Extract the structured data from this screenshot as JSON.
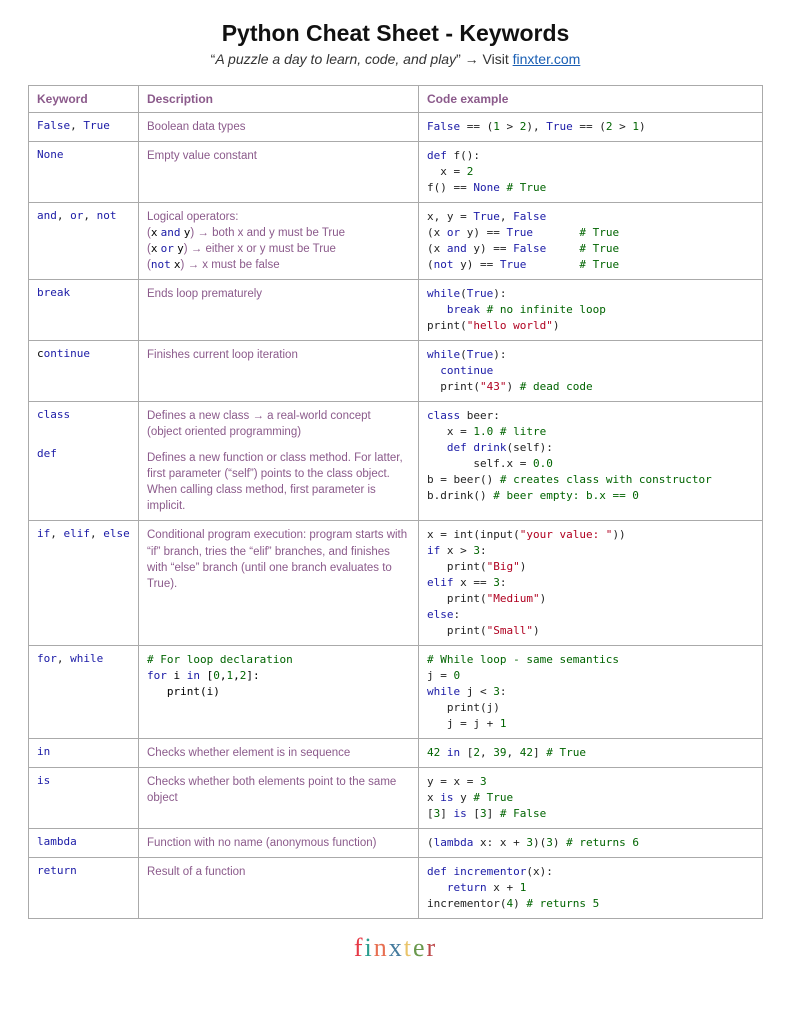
{
  "header": {
    "title": "Python Cheat Sheet - Keywords",
    "tagline_prefix": "“",
    "tagline": "A puzzle a day to learn, code, and play",
    "tagline_suffix": "” → Visit ",
    "link_text": "finxter.com"
  },
  "columns": {
    "keyword": "Keyword",
    "description": "Description",
    "code": "Code example"
  },
  "rows": [
    {
      "kw_html": "<span class='k'>False</span>, <span class='k'>True</span>",
      "desc_html": "Boolean data types",
      "code_html": "<span class='k'>False</span> == (<span class='n'>1</span> &gt; <span class='n'>2</span>), <span class='k'>True</span> == (<span class='n'>2</span> &gt; <span class='n'>1</span>)"
    },
    {
      "kw_html": "<span class='k'>None</span>",
      "desc_html": "Empty value constant",
      "code_html": "<span class='k'>def</span> f():\n  x = <span class='n'>2</span>\nf() == <span class='k'>None</span> <span class='c'># True</span>"
    },
    {
      "kw_html": "<span class='k'>and</span>, <span class='k'>or</span>, <span class='k'>not</span>",
      "desc_html": "Logical operators:<br>(<span class='code-inline bk'>x</span> <span class='code-inline k'>and</span> <span class='code-inline bk'>y</span>) → both x and y must be True<br>(<span class='code-inline bk'>x</span> <span class='code-inline k'>or</span> <span class='code-inline bk'>y</span>) → either x or y must be True<br>(<span class='code-inline k'>not</span> <span class='code-inline bk'>x</span>) → x must be false",
      "code_html": "x, y = <span class='k'>True</span>, <span class='k'>False</span>\n(x <span class='k'>or</span> y) == <span class='k'>True</span>       <span class='c'># True</span>\n(x <span class='k'>and</span> y) == <span class='k'>False</span>     <span class='c'># True</span>\n(<span class='k'>not</span> y) == <span class='k'>True</span>        <span class='c'># True</span>"
    },
    {
      "kw_html": "<span class='k'>break</span>",
      "desc_html": "Ends loop prematurely",
      "code_html": "<span class='k'>while</span>(<span class='k'>True</span>):\n   <span class='k'>break</span> <span class='c'># no infinite loop</span>\nprint(<span class='s'>\"hello world\"</span>)"
    },
    {
      "kw_html": "<span class='bk'>c</span><span class='k'>ontinue</span>",
      "desc_html": "Finishes current loop iteration",
      "code_html": "<span class='k'>while</span>(<span class='k'>True</span>):\n  <span class='k'>continue</span>\n  print(<span class='s'>\"43\"</span>) <span class='c'># dead code</span>"
    },
    {
      "kw_html": "<span class='k'>class</span>\n\n\n<span class='k'>def</span>",
      "desc_html": "<div class='desc-block'>Defines a new class → a real-world concept<br>(object oriented programming)</div><div class='desc-block'>Defines a new function or class method. For latter, first parameter (“self”) points to the class object. When calling class method, first parameter is implicit.</div>",
      "code_html": "<span class='k'>class</span> beer:\n   x = <span class='n'>1.0</span> <span class='c'># litre</span>\n   <span class='k'>def</span> <span class='k'>drink</span>(self):\n       self.x = <span class='n'>0.0</span>\nb = beer() <span class='c'># creates class with constructor</span>\nb.drink() <span class='c'># beer empty: b.x == 0</span>"
    },
    {
      "kw_html": "<span class='k'>if</span>, <span class='k'>elif</span>, <span class='k'>else</span>",
      "desc_html": "Conditional program execution: program starts with “if” branch, tries the “elif” branches, and finishes with “else” branch (until one branch evaluates to True).",
      "code_html": "x = int(input(<span class='s'>\"your value: \"</span>))\n<span class='k'>if</span> x &gt; <span class='n'>3</span>:\n   print(<span class='s'>\"Big\"</span>)\n<span class='k'>elif</span> x == <span class='n'>3</span>:\n   print(<span class='s'>\"Medium\"</span>)\n<span class='k'>else</span>:\n   print(<span class='s'>\"Small\"</span>)"
    },
    {
      "kw_html": "<span class='k'>for</span>, <span class='k'>while</span>",
      "desc_html": "<div class='desc-code'><span class='c'># For loop declaration</span>\n<span class='k'>for</span> i <span class='k'>in</span> [<span class='n'>0</span>,<span class='n'>1</span>,<span class='n'>2</span>]:\n   print(i)</div>",
      "code_html": "<span class='c'># While loop - same semantics</span>\nj = <span class='n'>0</span>\n<span class='k'>while</span> j &lt; <span class='n'>3</span>:\n   print(j)\n   j = j + <span class='n'>1</span>"
    },
    {
      "kw_html": "<span class='k'>in</span>",
      "desc_html": "Checks whether element is in sequence",
      "code_html": "<span class='n'>42</span> <span class='k'>in</span> [<span class='n'>2</span>, <span class='n'>39</span>, <span class='n'>42</span>] <span class='c'># True</span>"
    },
    {
      "kw_html": "<span class='k'>is</span>",
      "desc_html": "Checks whether both elements point to the same object",
      "code_html": "y = x = <span class='n'>3</span>\nx <span class='k'>is</span> y <span class='c'># True</span>\n[<span class='n'>3</span>] <span class='k'>is</span> [<span class='n'>3</span>] <span class='c'># False</span>"
    },
    {
      "kw_html": "<span class='k'>lambda</span>",
      "desc_html": "Function with no name (anonymous function)",
      "code_html": "(<span class='k'>lambda</span> x: x + <span class='n'>3</span>)(<span class='n'>3</span>) <span class='c'># returns 6</span>"
    },
    {
      "kw_html": "<span class='k'>return</span>",
      "desc_html": "Result of a function",
      "code_html": "<span class='k'>def</span> <span class='k'>incrementor</span>(x):\n   <span class='k'>return</span> x + <span class='n'>1</span>\nincrementor(<span class='n'>4</span>) <span class='c'># returns 5</span>"
    }
  ],
  "footer": {
    "logo": "finxter"
  }
}
